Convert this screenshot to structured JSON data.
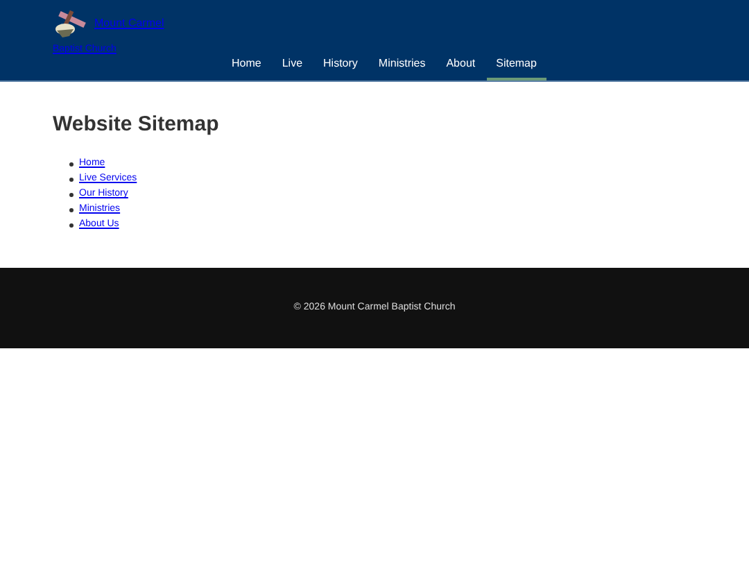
{
  "header": {
    "site_link_lines": [
      "Mount Carmel",
      "Baptist Church"
    ],
    "nav": [
      {
        "label": "Home",
        "selected": false
      },
      {
        "label": "Live",
        "selected": false
      },
      {
        "label": "History",
        "selected": false
      },
      {
        "label": "Ministries",
        "selected": false
      },
      {
        "label": "About",
        "selected": false
      },
      {
        "label": "Sitemap",
        "selected": true
      }
    ]
  },
  "main": {
    "title": "Website Sitemap",
    "links": [
      "Home",
      "Live Services",
      "Our History",
      "Ministries",
      "About Us"
    ]
  },
  "footer": {
    "text": "© 2026 Mount Carmel Baptist Church"
  }
}
